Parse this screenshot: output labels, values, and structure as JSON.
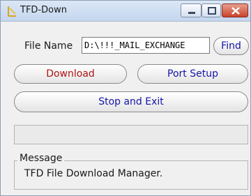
{
  "window": {
    "title": "TFD-Down",
    "icon": "folder-tool-icon"
  },
  "form": {
    "file_name_label": "File Name",
    "file_name_value": "D:\\!!!_MAIL_EXCHANGE",
    "find_label": "Find"
  },
  "buttons": {
    "download": "Download",
    "port_setup": "Port Setup",
    "stop_exit": "Stop and Exit"
  },
  "progress": {
    "fraction": 0
  },
  "message": {
    "group_label": "Message",
    "text": "TFD File Download Manager."
  },
  "colors": {
    "download_text": "#b11414",
    "button_text": "#1515a8",
    "close_button": "#c9432b"
  }
}
